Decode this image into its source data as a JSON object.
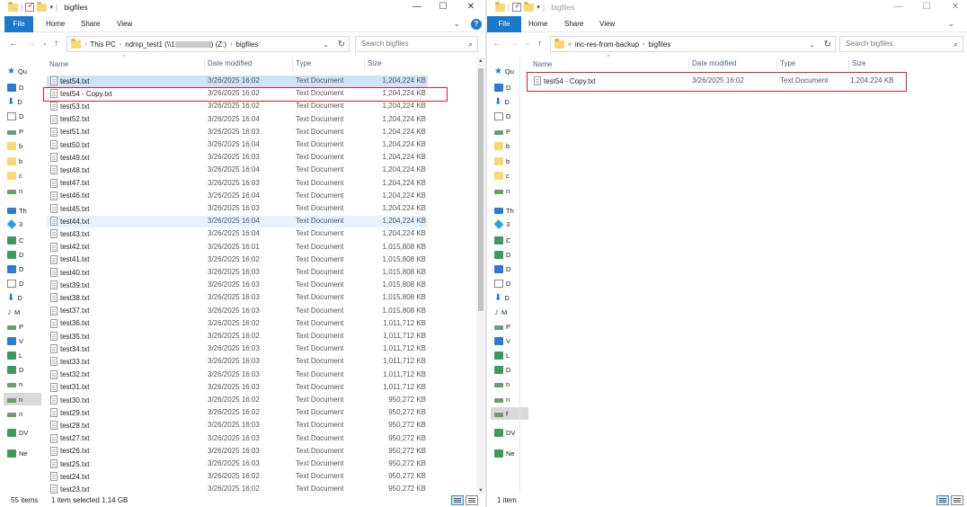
{
  "colors": {
    "accent": "#1979ca",
    "selection": "#cce4f7",
    "highlight": "#d3202a"
  },
  "left": {
    "title": "bigfiles",
    "window_controls": {
      "minimize": "—",
      "maximize": "☐",
      "close": "✕"
    },
    "ribbon_tabs": [
      "File",
      "Home",
      "Share",
      "View"
    ],
    "address": {
      "crumbs": [
        "This PC",
        "ndmp_test1 (\\\\1",
        ") (Z:)",
        "bigfiles"
      ]
    },
    "search_placeholder": "Search bigfiles",
    "nav_items": [
      "Qu",
      "D",
      "D",
      "D",
      "P",
      "b",
      "b",
      "c",
      "n",
      "Th",
      "3",
      "C",
      "D",
      "D",
      "D",
      "D",
      "M",
      "P",
      "V",
      "L",
      "D",
      "n",
      "n",
      "n",
      "DV",
      "Ne"
    ],
    "columns": {
      "name": "Name",
      "date": "Date modified",
      "type": "Type",
      "size": "Size"
    },
    "files": [
      {
        "name": "test54.txt",
        "date": "3/26/2025 16:02",
        "type": "Text Document",
        "size": "1,204,224 KB"
      },
      {
        "name": "test54 - Copy.txt",
        "date": "3/26/2025 16:02",
        "type": "Text Document",
        "size": "1,204,224 KB"
      },
      {
        "name": "test53.txt",
        "date": "3/26/2025 16:02",
        "type": "Text Document",
        "size": "1,204,224 KB"
      },
      {
        "name": "test52.txt",
        "date": "3/26/2025 16:04",
        "type": "Text Document",
        "size": "1,204,224 KB"
      },
      {
        "name": "test51.txt",
        "date": "3/26/2025 16:03",
        "type": "Text Document",
        "size": "1,204,224 KB"
      },
      {
        "name": "test50.txt",
        "date": "3/26/2025 16:04",
        "type": "Text Document",
        "size": "1,204,224 KB"
      },
      {
        "name": "test49.txt",
        "date": "3/26/2025 16:03",
        "type": "Text Document",
        "size": "1,204,224 KB"
      },
      {
        "name": "test48.txt",
        "date": "3/26/2025 16:04",
        "type": "Text Document",
        "size": "1,204,224 KB"
      },
      {
        "name": "test47.txt",
        "date": "3/26/2025 16:03",
        "type": "Text Document",
        "size": "1,204,224 KB"
      },
      {
        "name": "test46.txt",
        "date": "3/26/2025 16:04",
        "type": "Text Document",
        "size": "1,204,224 KB"
      },
      {
        "name": "test45.txt",
        "date": "3/26/2025 16:03",
        "type": "Text Document",
        "size": "1,204,224 KB"
      },
      {
        "name": "test44.txt",
        "date": "3/26/2025 16:04",
        "type": "Text Document",
        "size": "1,204,224 KB"
      },
      {
        "name": "test43.txt",
        "date": "3/26/2025 16:04",
        "type": "Text Document",
        "size": "1,204,224 KB"
      },
      {
        "name": "test42.txt",
        "date": "3/26/2025 16:01",
        "type": "Text Document",
        "size": "1,015,808 KB"
      },
      {
        "name": "test41.txt",
        "date": "3/26/2025 16:02",
        "type": "Text Document",
        "size": "1,015,808 KB"
      },
      {
        "name": "test40.txt",
        "date": "3/26/2025 16:03",
        "type": "Text Document",
        "size": "1,015,808 KB"
      },
      {
        "name": "test39.txt",
        "date": "3/26/2025 16:03",
        "type": "Text Document",
        "size": "1,015,808 KB"
      },
      {
        "name": "test38.txt",
        "date": "3/26/2025 16:03",
        "type": "Text Document",
        "size": "1,015,808 KB"
      },
      {
        "name": "test37.txt",
        "date": "3/26/2025 16:03",
        "type": "Text Document",
        "size": "1,015,808 KB"
      },
      {
        "name": "test36.txt",
        "date": "3/26/2025 16:02",
        "type": "Text Document",
        "size": "1,011,712 KB"
      },
      {
        "name": "test35.txt",
        "date": "3/26/2025 16:02",
        "type": "Text Document",
        "size": "1,011,712 KB"
      },
      {
        "name": "test34.txt",
        "date": "3/26/2025 16:03",
        "type": "Text Document",
        "size": "1,011,712 KB"
      },
      {
        "name": "test33.txt",
        "date": "3/26/2025 16:03",
        "type": "Text Document",
        "size": "1,011,712 KB"
      },
      {
        "name": "test32.txt",
        "date": "3/26/2025 16:03",
        "type": "Text Document",
        "size": "1,011,712 KB"
      },
      {
        "name": "test31.txt",
        "date": "3/26/2025 16:03",
        "type": "Text Document",
        "size": "1,011,712 KB"
      },
      {
        "name": "test30.txt",
        "date": "3/26/2025 16:02",
        "type": "Text Document",
        "size": "950,272 KB"
      },
      {
        "name": "test29.txt",
        "date": "3/26/2025 16:02",
        "type": "Text Document",
        "size": "950,272 KB"
      },
      {
        "name": "test28.txt",
        "date": "3/26/2025 16:03",
        "type": "Text Document",
        "size": "950,272 KB"
      },
      {
        "name": "test27.txt",
        "date": "3/26/2025 16:03",
        "type": "Text Document",
        "size": "950,272 KB"
      },
      {
        "name": "test26.txt",
        "date": "3/26/2025 16:03",
        "type": "Text Document",
        "size": "950,272 KB"
      },
      {
        "name": "test25.txt",
        "date": "3/26/2025 16:03",
        "type": "Text Document",
        "size": "950,272 KB"
      },
      {
        "name": "test24.txt",
        "date": "3/26/2025 16:02",
        "type": "Text Document",
        "size": "950,272 KB"
      },
      {
        "name": "test23.txt",
        "date": "3/26/2025 16:02",
        "type": "Text Document",
        "size": "950,272 KB"
      }
    ],
    "selected_indices": [
      0
    ],
    "hover_indices": [
      11
    ],
    "highlighted_index": 1,
    "status": {
      "count": "55 items",
      "selection": "1 item selected  1.14 GB"
    }
  },
  "right": {
    "title": "bigfiles",
    "window_controls": {
      "minimize": "—",
      "maximize": "☐",
      "close": "✕"
    },
    "ribbon_tabs": [
      "File",
      "Home",
      "Share",
      "View"
    ],
    "address": {
      "crumbs": [
        "«",
        "inc-res-from-backup",
        "bigfiles"
      ]
    },
    "search_placeholder": "Search bigfiles",
    "nav_items": [
      "Qu",
      "D",
      "D",
      "D",
      "P",
      "b",
      "b",
      "c",
      "n",
      "Th",
      "3",
      "C",
      "D",
      "D",
      "D",
      "D",
      "M",
      "P",
      "V",
      "L",
      "D",
      "n",
      "n",
      "f",
      "DV",
      "Ne"
    ],
    "columns": {
      "name": "Name",
      "date": "Date modified",
      "type": "Type",
      "size": "Size"
    },
    "files": [
      {
        "name": "test54 - Copy.txt",
        "date": "3/26/2025 16:02",
        "type": "Text Document",
        "size": "1,204,224 KB"
      }
    ],
    "status": {
      "count": "1 item"
    }
  }
}
